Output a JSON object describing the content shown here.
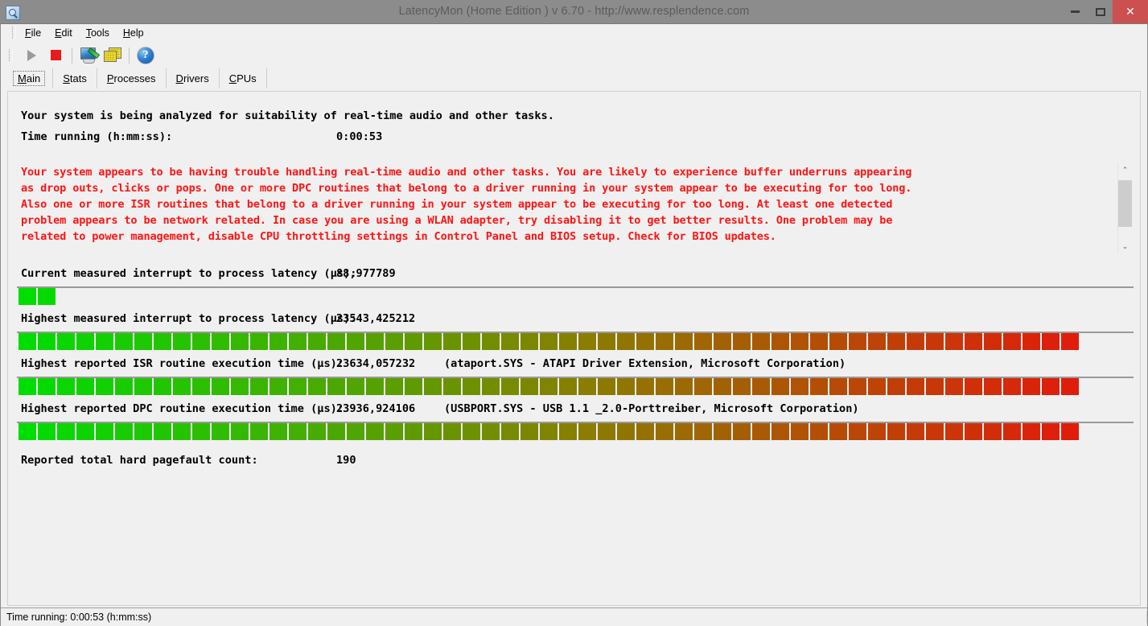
{
  "window": {
    "title": "LatencyMon  (Home Edition )  v 6.70 - http://www.resplendence.com",
    "icon": "app-magnifier-icon",
    "minimize_label": "–",
    "maximize_label": "□",
    "close_label": "✕"
  },
  "menu": {
    "items": [
      {
        "pre": "",
        "accel": "F",
        "post": "ile"
      },
      {
        "pre": "",
        "accel": "E",
        "post": "dit"
      },
      {
        "pre": "",
        "accel": "T",
        "post": "ools"
      },
      {
        "pre": "",
        "accel": "H",
        "post": "elp"
      }
    ]
  },
  "toolbar": {
    "buttons": [
      {
        "name": "start-monitoring-button",
        "icon": "play-icon",
        "enabled": false
      },
      {
        "name": "stop-monitoring-button",
        "icon": "stop-icon",
        "enabled": true
      },
      {
        "name": "report-button",
        "icon": "monitor-pen-icon",
        "enabled": true
      },
      {
        "name": "copy-button",
        "icon": "layers-icon",
        "enabled": true
      },
      {
        "name": "help-button",
        "icon": "help-icon",
        "glyph": "?",
        "enabled": true
      }
    ]
  },
  "tabs": [
    {
      "accel": "M",
      "post": "ain",
      "active": true
    },
    {
      "accel": "S",
      "post": "tats",
      "active": false
    },
    {
      "accel": "P",
      "post": "rocesses",
      "active": false
    },
    {
      "accel": "D",
      "post": "rivers",
      "active": false
    },
    {
      "accel": "C",
      "post": "PUs",
      "active": false
    }
  ],
  "header": {
    "line1": "Your system is being analyzed for suitability of real-time audio and other tasks.",
    "time_label": "Time running (h:mm:ss):",
    "time_value": "0:00:53"
  },
  "warning": {
    "color": "#ff1414",
    "lines": [
      "Your system appears to be having trouble handling real-time audio and other tasks. You are likely to experience buffer underruns appearing",
      "as drop outs, clicks or pops. One or more DPC routines that belong to a driver running in your system appear to be executing for too long.",
      "Also one or more ISR routines that belong to a driver running in your system appear to be executing for too long. At least one detected",
      "problem appears to be network related. In case you are using a WLAN adapter, try disabling it to get better results. One problem may be",
      "related to power management, disable CPU throttling settings in Control Panel and BIOS setup. Check for BIOS updates."
    ],
    "scroll_up": "⌃",
    "scroll_down": "⌄"
  },
  "metrics": [
    {
      "name": "current-interrupt-latency",
      "label": "Current measured interrupt to process latency (µs):",
      "value": "88,977789",
      "extra": "",
      "bar_segments": 2,
      "bar_total": 59
    },
    {
      "name": "highest-interrupt-latency",
      "label": "Highest measured interrupt to process latency (µs):",
      "value": "23543,425212",
      "extra": "",
      "bar_segments": 55,
      "bar_total": 59
    },
    {
      "name": "highest-isr-execution-time",
      "label": "Highest reported ISR routine execution time (µs):",
      "value": "23634,057232",
      "extra": "(ataport.SYS - ATAPI Driver Extension, Microsoft Corporation)",
      "bar_segments": 55,
      "bar_total": 59
    },
    {
      "name": "highest-dpc-execution-time",
      "label": "Highest reported DPC routine execution time (µs):",
      "value": "23936,924106",
      "extra": "(USBPORT.SYS - USB 1.1 _2.0-Porttreiber, Microsoft Corporation)",
      "bar_segments": 55,
      "bar_total": 59
    }
  ],
  "pagefault": {
    "label": "Reported total hard pagefault count:",
    "value": "190"
  },
  "statusbar": {
    "text": "Time running: 0:00:53  (h:mm:ss)"
  },
  "colors": {
    "bar_start": "#00dd00",
    "bar_mid": "#8a7d00",
    "bar_end": "#ee0d0d",
    "titlebar": "#8c8c8c",
    "close_button": "#cc5050",
    "warning_text": "#ff1414"
  }
}
